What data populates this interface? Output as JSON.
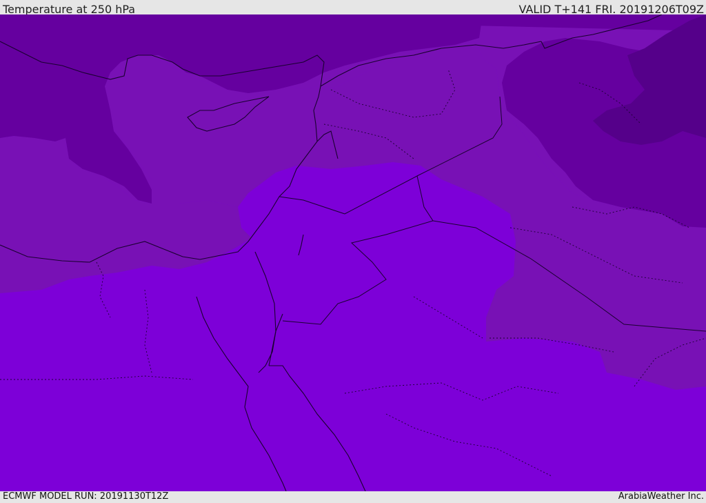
{
  "header": {
    "title": "Temperature at 250 hPa",
    "valid": "VALID T+141 FRI. 20191206T09Z"
  },
  "footer": {
    "model_run": "ECMWF MODEL RUN: 20191130T12Z",
    "credit": "ArabiaWeather Inc."
  },
  "colors": {
    "coldest": "#55008a",
    "cold": "#65009f",
    "mid": "#7811b5",
    "warm": "#7d00d8",
    "lines": "#1a0030"
  }
}
